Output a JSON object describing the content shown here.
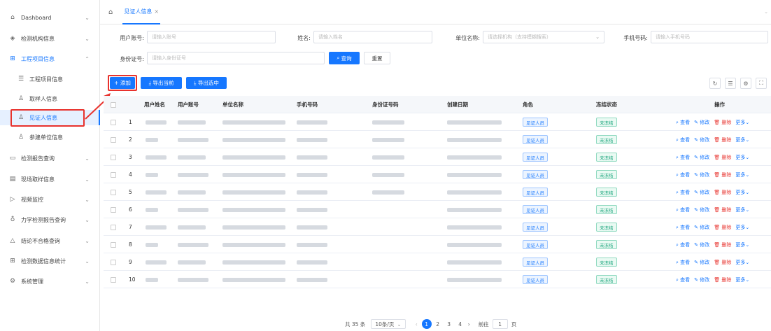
{
  "sidebar": {
    "items": [
      {
        "label": "Dashboard",
        "icon": "home-icon"
      },
      {
        "label": "检测机构信息",
        "icon": "layers-icon"
      },
      {
        "label": "工程项目信息",
        "icon": "grid-icon",
        "open": true
      },
      {
        "label": "工程项目信息",
        "icon": "sliders-icon",
        "sub": true
      },
      {
        "label": "取样人信息",
        "icon": "user-icon",
        "sub": true
      },
      {
        "label": "见证人信息",
        "icon": "user-icon",
        "sub": true,
        "active": true
      },
      {
        "label": "参建单位信息",
        "icon": "user-icon",
        "sub": true
      },
      {
        "label": "检测报告查询",
        "icon": "inbox-icon"
      },
      {
        "label": "现场取样信息",
        "icon": "clipboard-icon"
      },
      {
        "label": "视频监控",
        "icon": "video-icon"
      },
      {
        "label": "力学检测报告查询",
        "icon": "bulb-icon"
      },
      {
        "label": "结论不合格查询",
        "icon": "bell-icon"
      },
      {
        "label": "检测数据信息统计",
        "icon": "grid-icon"
      },
      {
        "label": "系统管理",
        "icon": "gear-icon"
      }
    ]
  },
  "tabs": {
    "active": "见证人信息",
    "close": "×"
  },
  "filters": {
    "account_label": "用户账号:",
    "account_placeholder": "请输入账号",
    "name_label": "姓名:",
    "name_placeholder": "请输入姓名",
    "unit_label": "单位名称:",
    "unit_placeholder": "请选择机构（支持模糊搜索）",
    "phone_label": "手机号码:",
    "phone_placeholder": "请输入手机号码",
    "idcard_label": "身份证号:",
    "idcard_placeholder": "请输入身份证号",
    "search_label": "查询",
    "reset_label": "重置"
  },
  "toolbar": {
    "add_label": "+ 添加",
    "export_current_label": "⤓ 导出当前",
    "export_selected_label": "⤓ 导出选中"
  },
  "table": {
    "columns": [
      "用户姓名",
      "用户账号",
      "单位名称",
      "手机号码",
      "身份证号码",
      "创建日期",
      "角色",
      "冻结状态",
      "操作"
    ],
    "rows": [
      {
        "no": "1",
        "role": "见证人员",
        "status": "未冻结"
      },
      {
        "no": "2",
        "role": "见证人员",
        "status": "未冻结"
      },
      {
        "no": "3",
        "role": "见证人员",
        "status": "未冻结"
      },
      {
        "no": "4",
        "role": "见证人员",
        "status": "未冻结"
      },
      {
        "no": "5",
        "role": "见证人员",
        "status": "未冻结"
      },
      {
        "no": "6",
        "role": "见证人员",
        "status": "未冻结"
      },
      {
        "no": "7",
        "role": "见证人员",
        "status": "未冻结"
      },
      {
        "no": "8",
        "role": "见证人员",
        "status": "未冻结"
      },
      {
        "no": "9",
        "role": "见证人员",
        "status": "未冻结"
      },
      {
        "no": "10",
        "role": "见证人员",
        "status": "未冻结"
      }
    ],
    "actions": {
      "view": "查看",
      "edit": "修改",
      "delete": "删除",
      "more": "更多"
    }
  },
  "pagination": {
    "total": "共 35 条",
    "page_size": "10条/页",
    "pages": [
      "1",
      "2",
      "3",
      "4"
    ],
    "current": "1",
    "goto_label": "前往",
    "goto_value": "1",
    "page_suffix": "页"
  },
  "colors": {
    "accent": "#1677ff",
    "danger": "#e8322d",
    "success": "#16a37a"
  }
}
